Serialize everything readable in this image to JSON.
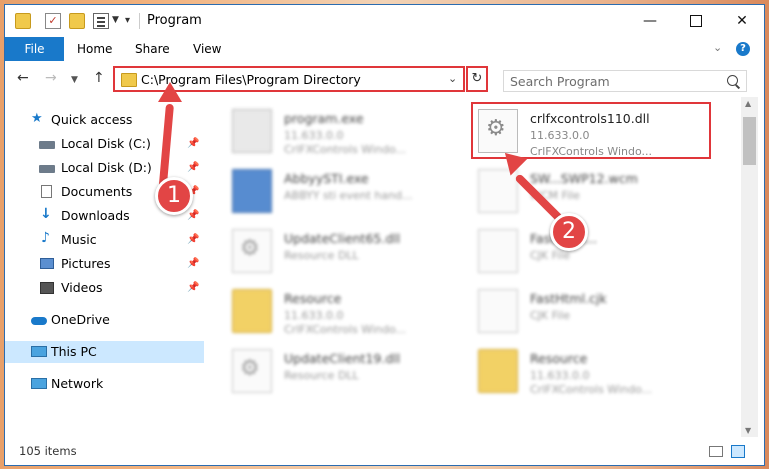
{
  "window": {
    "title": "Program",
    "controls": {
      "minimize": "—",
      "maximize": "",
      "close": "✕"
    }
  },
  "ribbon": {
    "tabs": [
      {
        "label": "File",
        "active": true
      },
      {
        "label": "Home"
      },
      {
        "label": "Share"
      },
      {
        "label": "View"
      }
    ],
    "help": "?"
  },
  "navigation": {
    "address": "C:\\Program Files\\Program Directory",
    "search_placeholder": "Search Program"
  },
  "sidebar": {
    "items": [
      {
        "label": "Quick access",
        "icon": "star-icon",
        "color": "#1979ca"
      },
      {
        "label": "Local Disk (C:)",
        "icon": "drive-icon",
        "pinned": true
      },
      {
        "label": "Local Disk (D:)",
        "icon": "drive-icon",
        "pinned": true
      },
      {
        "label": "Documents",
        "icon": "documents-icon",
        "pinned": true
      },
      {
        "label": "Downloads",
        "icon": "download-icon",
        "pinned": true
      },
      {
        "label": "Music",
        "icon": "music-icon",
        "pinned": true
      },
      {
        "label": "Pictures",
        "icon": "pictures-icon",
        "pinned": true
      },
      {
        "label": "Videos",
        "icon": "videos-icon",
        "pinned": true
      },
      {
        "label": "OneDrive",
        "icon": "cloud-icon"
      },
      {
        "label": "This PC",
        "icon": "computer-icon",
        "selected": true
      },
      {
        "label": "Network",
        "icon": "network-icon"
      }
    ]
  },
  "files": [
    {
      "name": "program.exe",
      "line2": "11.633.0.0",
      "line3": "CrlFXControls Windo...",
      "icon": "exe-icon"
    },
    {
      "name": "crlfxcontrols110.dll",
      "line2": "11.633.0.0",
      "line3": "CrlFXControls Windo...",
      "icon": "dll-gear-icon",
      "highlighted": true
    },
    {
      "name": "AbbyySTI.exe",
      "line2": "ABBYY sti event hand...",
      "icon": "app-icon"
    },
    {
      "name": "SW...SWP12.wcm",
      "line2": "WCM File",
      "icon": "document-icon"
    },
    {
      "name": "UpdateClient65.dll",
      "line2": "Resource DLL",
      "icon": "dll-gear-icon"
    },
    {
      "name": "FastHtml...",
      "line2": "CJK File",
      "icon": "document-icon"
    },
    {
      "name": "Resource",
      "line2": "11.633.0.0",
      "line3": "CrlFXControls Windo...",
      "icon": "folder-icon"
    },
    {
      "name": "FastHtml.cjk",
      "line2": "CJK File",
      "icon": "document-icon"
    },
    {
      "name": "UpdateClient19.dll",
      "line2": "Resource DLL",
      "icon": "dll-gear-icon"
    },
    {
      "name": "Resource",
      "line2": "11.633.0.0",
      "line3": "CrlFXControls Windo...",
      "icon": "folder-icon"
    }
  ],
  "status": {
    "item_count": "105 items"
  },
  "annotations": {
    "step1": "1",
    "step2": "2",
    "highlight_color": "#e0363a"
  }
}
